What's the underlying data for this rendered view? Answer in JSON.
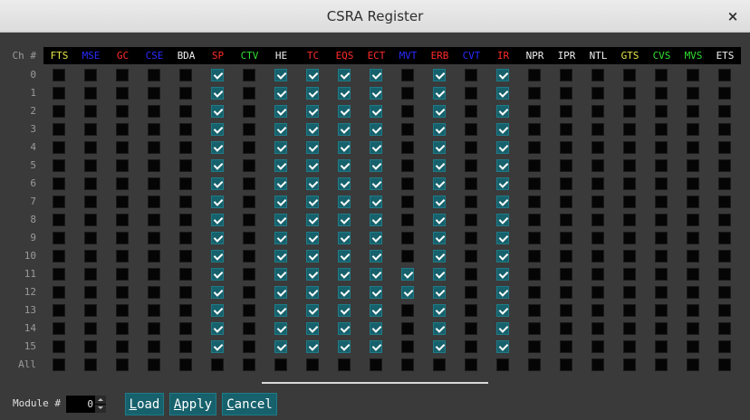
{
  "window": {
    "title": "CSRA Register",
    "close_glyph": "×"
  },
  "grid": {
    "channel_header": "Ch #",
    "columns": [
      {
        "label": "FTS",
        "color": "#e6e64a"
      },
      {
        "label": "MSE",
        "color": "#2a2aff"
      },
      {
        "label": "GC",
        "color": "#ff2a2a"
      },
      {
        "label": "CSE",
        "color": "#2a2aff"
      },
      {
        "label": "BDA",
        "color": "#f0f0f0"
      },
      {
        "label": "SP",
        "color": "#ff2a2a"
      },
      {
        "label": "CTV",
        "color": "#33dd33"
      },
      {
        "label": "HE",
        "color": "#f0f0f0"
      },
      {
        "label": "TC",
        "color": "#ff2a2a"
      },
      {
        "label": "EQS",
        "color": "#ff2a2a"
      },
      {
        "label": "ECT",
        "color": "#ff2a2a"
      },
      {
        "label": "MVT",
        "color": "#2a2aff"
      },
      {
        "label": "ERB",
        "color": "#ff2a2a"
      },
      {
        "label": "CVT",
        "color": "#2a2aff"
      },
      {
        "label": "IR",
        "color": "#ff2a2a"
      },
      {
        "label": "NPR",
        "color": "#f0f0f0"
      },
      {
        "label": "IPR",
        "color": "#f0f0f0"
      },
      {
        "label": "NTL",
        "color": "#f0f0f0"
      },
      {
        "label": "GTS",
        "color": "#e6e64a"
      },
      {
        "label": "CVS",
        "color": "#33dd33"
      },
      {
        "label": "MVS",
        "color": "#33dd33"
      },
      {
        "label": "ETS",
        "color": "#f0f0f0"
      }
    ],
    "rows": [
      {
        "label": "0",
        "checked": [
          "SP",
          "HE",
          "TC",
          "EQS",
          "ECT",
          "ERB",
          "IR"
        ]
      },
      {
        "label": "1",
        "checked": [
          "SP",
          "HE",
          "TC",
          "EQS",
          "ECT",
          "ERB",
          "IR"
        ]
      },
      {
        "label": "2",
        "checked": [
          "SP",
          "HE",
          "TC",
          "EQS",
          "ECT",
          "ERB",
          "IR"
        ]
      },
      {
        "label": "3",
        "checked": [
          "SP",
          "HE",
          "TC",
          "EQS",
          "ECT",
          "ERB",
          "IR"
        ]
      },
      {
        "label": "4",
        "checked": [
          "SP",
          "HE",
          "TC",
          "EQS",
          "ECT",
          "ERB",
          "IR"
        ]
      },
      {
        "label": "5",
        "checked": [
          "SP",
          "HE",
          "TC",
          "EQS",
          "ECT",
          "ERB",
          "IR"
        ]
      },
      {
        "label": "6",
        "checked": [
          "SP",
          "HE",
          "TC",
          "EQS",
          "ECT",
          "ERB",
          "IR"
        ]
      },
      {
        "label": "7",
        "checked": [
          "SP",
          "HE",
          "TC",
          "EQS",
          "ECT",
          "ERB",
          "IR"
        ]
      },
      {
        "label": "8",
        "checked": [
          "SP",
          "HE",
          "TC",
          "EQS",
          "ECT",
          "ERB",
          "IR"
        ]
      },
      {
        "label": "9",
        "checked": [
          "SP",
          "HE",
          "TC",
          "EQS",
          "ECT",
          "ERB",
          "IR"
        ]
      },
      {
        "label": "10",
        "checked": [
          "SP",
          "HE",
          "TC",
          "EQS",
          "ECT",
          "ERB",
          "IR"
        ]
      },
      {
        "label": "11",
        "checked": [
          "SP",
          "HE",
          "TC",
          "EQS",
          "ECT",
          "MVT",
          "ERB",
          "IR"
        ]
      },
      {
        "label": "12",
        "checked": [
          "SP",
          "HE",
          "TC",
          "EQS",
          "ECT",
          "MVT",
          "ERB",
          "IR"
        ]
      },
      {
        "label": "13",
        "checked": [
          "SP",
          "HE",
          "TC",
          "EQS",
          "ECT",
          "ERB",
          "IR"
        ]
      },
      {
        "label": "14",
        "checked": [
          "SP",
          "HE",
          "TC",
          "EQS",
          "ECT",
          "ERB",
          "IR"
        ]
      },
      {
        "label": "15",
        "checked": [
          "SP",
          "HE",
          "TC",
          "EQS",
          "ECT",
          "ERB",
          "IR"
        ]
      }
    ],
    "all_row_label": "All"
  },
  "footer": {
    "module_label": "Module #",
    "module_value": "0",
    "buttons": [
      {
        "key": "L",
        "rest": "oad"
      },
      {
        "key": "A",
        "rest": "pply"
      },
      {
        "key": "C",
        "rest": "ancel"
      }
    ]
  }
}
